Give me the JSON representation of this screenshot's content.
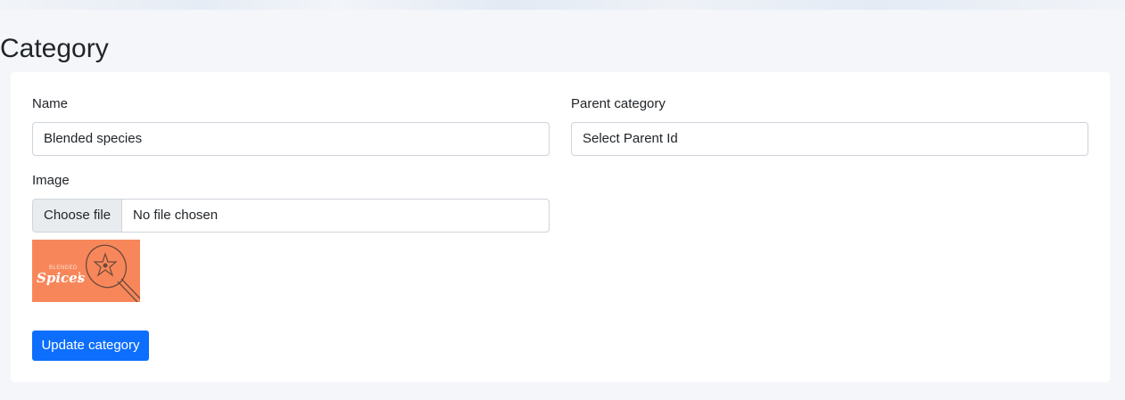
{
  "page": {
    "title": "Category"
  },
  "form": {
    "name": {
      "label": "Name",
      "value": "Blended species"
    },
    "parent": {
      "label": "Parent category",
      "value": "Select Parent Id"
    },
    "image": {
      "label": "Image",
      "button_label": "Choose file",
      "status": "No file chosen",
      "thumbnail": {
        "small_text": "BLENDED",
        "script_text": "Spices",
        "background_color": "#f7875a"
      }
    },
    "submit_label": "Update category"
  },
  "colors": {
    "primary": "#0d6efd",
    "page_bg": "#f4f6f9",
    "card_bg": "#ffffff"
  }
}
